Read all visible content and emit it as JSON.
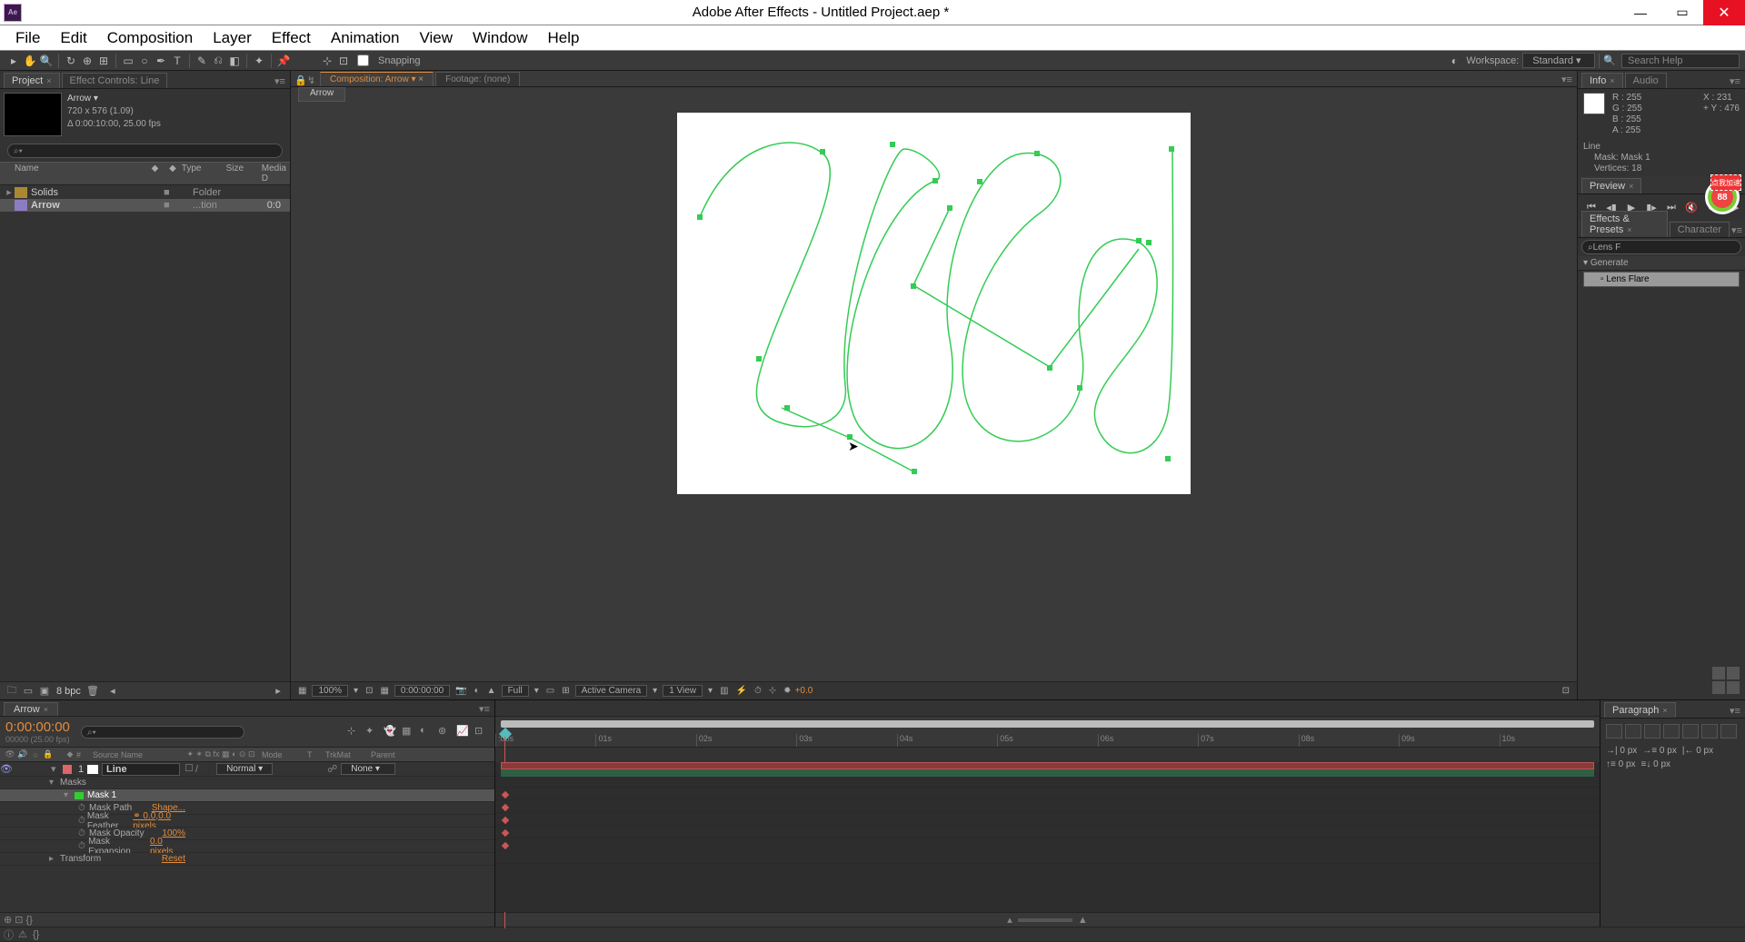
{
  "title": "Adobe After Effects - Untitled Project.aep *",
  "ae_logo": "Ae",
  "menu": [
    "File",
    "Edit",
    "Composition",
    "Layer",
    "Effect",
    "Animation",
    "View",
    "Window",
    "Help"
  ],
  "toolbar": {
    "snapping": "Snapping",
    "workspace_label": "Workspace:",
    "workspace_value": "Standard",
    "search_placeholder": "Search Help"
  },
  "project": {
    "tab": "Project",
    "effect_controls_tab": "Effect Controls: Line",
    "comp_name": "Arrow ▾",
    "resolution": "720 x 576 (1.09)",
    "duration": "Δ 0:00:10:00, 25.00 fps",
    "search_glyph": "⌕▾",
    "cols": {
      "name": "Name",
      "type": "Type",
      "size": "Size",
      "media": "Media D"
    },
    "rows": [
      {
        "name": "Solids",
        "type": "Folder",
        "sel": false,
        "icon": "folder"
      },
      {
        "name": "Arrow",
        "type": "...tion",
        "sel": true,
        "icon": "comp",
        "extra": "0:0"
      }
    ],
    "footer_bpc": "8 bpc"
  },
  "comp": {
    "tab_label": "Composition: Arrow",
    "tab2": "Footage: (none)",
    "subtab": "Arrow",
    "footer": {
      "zoom": "100%",
      "time": "0:00:00:00",
      "res": "Full",
      "camera": "Active Camera",
      "views": "1 View",
      "exposure": "+0.0"
    }
  },
  "info": {
    "tab": "Info",
    "audio_tab": "Audio",
    "r": "R : 255",
    "g": "G : 255",
    "b": "B : 255",
    "a": "A : 255",
    "x": "X : 231",
    "y": "Y : 476",
    "layer": "Line",
    "mask": "Mask: Mask 1",
    "vertices": "Vertices: 18"
  },
  "preview": {
    "tab": "Preview"
  },
  "effects": {
    "tab": "Effects & Presets",
    "char_tab": "Character",
    "search": "Lens F",
    "category": "Generate",
    "item": "Lens Flare"
  },
  "timeline": {
    "tab": "Arrow",
    "timecode": "0:00:00:00",
    "timecode2": "00000 (25.00 fps)",
    "source_name": "Source Name",
    "mode_col": "Mode",
    "trkmat_col": "TrkMat",
    "parent_col": "Parent",
    "layer": {
      "idx": "1",
      "name": "Line",
      "mode": "Normal",
      "parent": "None"
    },
    "groups": {
      "masks": "Masks",
      "mask1": "Mask 1",
      "transform": "Transform"
    },
    "props": {
      "path": {
        "label": "Mask Path",
        "val": "Shape..."
      },
      "feather": {
        "label": "Mask Feather",
        "val": "0.0,0.0 pixels"
      },
      "opacity": {
        "label": "Mask Opacity",
        "val": "100%"
      },
      "expansion": {
        "label": "Mask Expansion",
        "val": "0.0 pixels"
      },
      "reset": "Reset"
    },
    "ticks": [
      ":00s",
      "01s",
      "02s",
      "03s",
      "04s",
      "05s",
      "06s",
      "07s",
      "08s",
      "09s",
      "10s"
    ]
  },
  "paragraph": {
    "tab": "Paragraph",
    "vals": {
      "a": "0 px",
      "b": "0 px",
      "c": "0 px",
      "d": "0 px",
      "e": "0 px"
    }
  },
  "watermark": {
    "text": "点我加速",
    "num": "88"
  }
}
